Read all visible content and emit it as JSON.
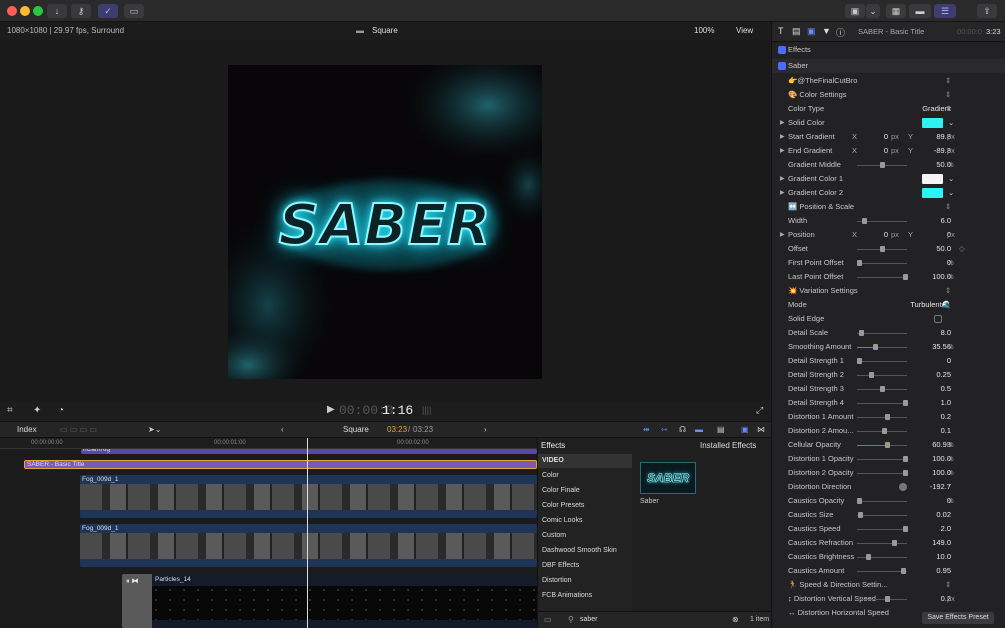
{
  "toolbar": {
    "colors": {
      "close": "#ff5f57",
      "min": "#febc2e",
      "max": "#28c840",
      "accent": "#6b6bff"
    }
  },
  "viewer": {
    "format": "1080×1080 | 29.97 fps, Surround",
    "project_name": "Square",
    "zoom": "100%",
    "view_label": "View",
    "title_text": "SABER",
    "timecode": "00:00:01:16",
    "timecode_dim": "00:00:0",
    "timecode_bright": "1:16"
  },
  "timeline_bar": {
    "index_label": "Index",
    "project": "Square",
    "position": "03:23",
    "duration": "03:23",
    "separator": "/"
  },
  "timeline": {
    "ruler": [
      "00:00:00:00",
      "00:00:01:00",
      "00:00:02:00"
    ],
    "clips": {
      "top": "nCamRig",
      "title": "SABER - Basic Title",
      "fog1": "Fog_009d_1",
      "fog2": "Fog_009d_1",
      "particles": "Particles_14"
    }
  },
  "inspector": {
    "title": "SABER - Basic Title",
    "duration": "3:23",
    "duration_dim": "00:00:0",
    "effects_label": "Effects",
    "effect_name": "Saber",
    "rows": [
      {
        "label": "👉@TheFinalCutBro",
        "val": "",
        "unit": ""
      },
      {
        "label": "🎨 Color Settings",
        "val": "",
        "unit": ""
      },
      {
        "label": "Color Type",
        "val": "Gradient",
        "unit": ""
      },
      {
        "label": "Solid Color",
        "val": "",
        "unit": ""
      },
      {
        "label": "Start Gradient",
        "val": "89.8",
        "unit": "px"
      },
      {
        "label": "End Gradient",
        "val": "-89.8",
        "unit": "px"
      },
      {
        "label": "Gradient Middle",
        "val": "50.0",
        "unit": "%"
      },
      {
        "label": "Gradient Color 1",
        "val": "",
        "unit": ""
      },
      {
        "label": "Gradient Color 2",
        "val": "",
        "unit": ""
      },
      {
        "label": "↔️ Position & Scale",
        "val": "",
        "unit": ""
      },
      {
        "label": "Width",
        "val": "6.0",
        "unit": ""
      },
      {
        "label": "Position",
        "val": "0",
        "unit": "px"
      },
      {
        "label": "Offset",
        "val": "50.0",
        "unit": ""
      },
      {
        "label": "First Point Offset",
        "val": "0",
        "unit": "%"
      },
      {
        "label": "Last Point Offset",
        "val": "100.0",
        "unit": "%"
      },
      {
        "label": "💥 Variation Settings",
        "val": "",
        "unit": ""
      },
      {
        "label": "Mode",
        "val": "Turbulent🌊",
        "unit": ""
      },
      {
        "label": "Solid Edge",
        "val": "",
        "unit": ""
      },
      {
        "label": "Detail Scale",
        "val": "8.0",
        "unit": ""
      },
      {
        "label": "Smoothing Amount",
        "val": "35.56",
        "unit": "%"
      },
      {
        "label": "Detail Strength 1",
        "val": "0",
        "unit": ""
      },
      {
        "label": "Detail Strength 2",
        "val": "0.25",
        "unit": ""
      },
      {
        "label": "Detail Strength 3",
        "val": "0.5",
        "unit": ""
      },
      {
        "label": "Detail Strength 4",
        "val": "1.0",
        "unit": ""
      },
      {
        "label": "Distortion 1 Amount",
        "val": "0.2",
        "unit": ""
      },
      {
        "label": "Distortion 2 Amou...",
        "val": "0.1",
        "unit": ""
      },
      {
        "label": "Cellular Opacity",
        "val": "60.93",
        "unit": "%"
      },
      {
        "label": "Distortion 1 Opacity",
        "val": "100.0",
        "unit": "%"
      },
      {
        "label": "Distortion 2 Opacity",
        "val": "100.0",
        "unit": "%"
      },
      {
        "label": "Distortion Direction",
        "val": "-192.7",
        "unit": "°"
      },
      {
        "label": "Caustics Opacity",
        "val": "0",
        "unit": "%"
      },
      {
        "label": "Caustics Size",
        "val": "0.02",
        "unit": ""
      },
      {
        "label": "Caustics Speed",
        "val": "2.0",
        "unit": ""
      },
      {
        "label": "Caustics Refraction",
        "val": "149.0",
        "unit": ""
      },
      {
        "label": "Caustics Brightness",
        "val": "10.0",
        "unit": ""
      },
      {
        "label": "Caustics Amount",
        "val": "0.95",
        "unit": ""
      },
      {
        "label": "🏃 Speed & Direction Settin...",
        "val": "",
        "unit": ""
      },
      {
        "label": "↕ Distortion Vertical Speed",
        "val": "0.2",
        "unit": "px"
      },
      {
        "label": "↔ Distortion Horizontal Speed",
        "val": "",
        "unit": ""
      }
    ],
    "xy": {
      "x": "X",
      "y": "Y",
      "start_x": "0",
      "end_x": "0",
      "pos_y": "0",
      "px": "px"
    },
    "sliders": {
      "gradient_middle": 0.5,
      "width": 0.1,
      "offset": 0.5,
      "first_point": 0.0,
      "last_point": 1.0,
      "detail_scale": 0.04,
      "smoothing": 0.3556,
      "detail1": 0.0,
      "detail2": 0.25,
      "detail3": 0.5,
      "detail4": 1.0,
      "dist1": 0.6,
      "dist2": 0.55,
      "cellular": 0.6093,
      "dist1op": 1.0,
      "dist2op": 1.0,
      "caustics_op": 0.0,
      "caustics_size": 0.02,
      "caustics_speed": 1.0,
      "caustics_refr": 0.75,
      "caustics_bright": 0.2,
      "caustics_amount": 0.95,
      "vert_speed": 0.6
    },
    "colors": {
      "solid": "#2ef3f3",
      "grad1": "#f4f4f4",
      "grad2": "#2ef3f3"
    },
    "save_preset": "Save Effects Preset"
  },
  "effects": {
    "title": "Effects",
    "installed": "Installed Effects",
    "categories": [
      "VIDEO",
      "Color",
      "Color Finale",
      "Color Presets",
      "Comic Looks",
      "Custom",
      "Dashwood Smooth Skin",
      "DBF Effects",
      "Distortion",
      "FCB Animations"
    ],
    "thumb_label": "SABER",
    "item_name": "Saber",
    "search": "saber",
    "count": "1 item"
  }
}
